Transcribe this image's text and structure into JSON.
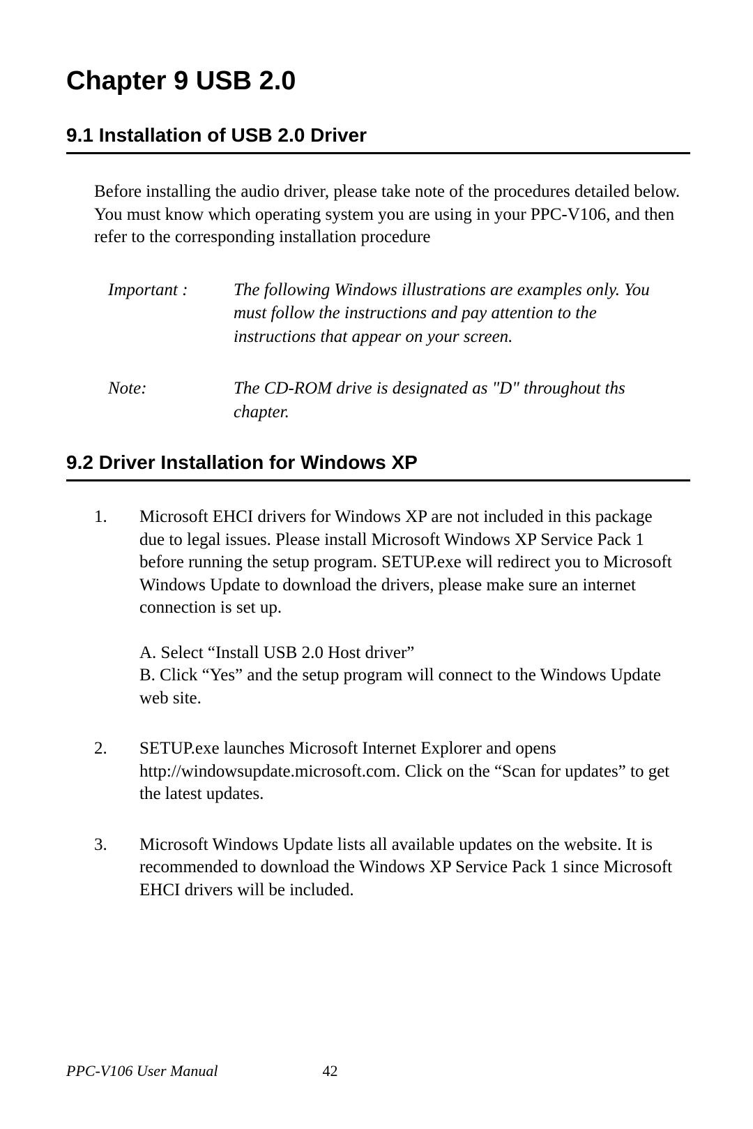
{
  "chapterTitle": "Chapter 9  USB 2.0",
  "section91": {
    "heading": "9.1  Installation of USB 2.0 Driver",
    "paragraph": "Before installing the audio driver, please take note of the procedures detailed below. You must know which operating system you are using in your PPC-V106, and then refer to the corresponding installation procedure"
  },
  "importantRow": {
    "label": "Important :",
    "text": "The following Windows illustrations are examples only. You must follow the instructions and pay attention to the instructions that appear on your screen."
  },
  "noteRow": {
    "label": "Note:",
    "text": "The CD-ROM drive is designated as \"D\" throughout ths chapter."
  },
  "section92": {
    "heading": "9.2  Driver Installation for Windows XP",
    "items": [
      {
        "num": "1.",
        "text": "Microsoft EHCI drivers for Windows XP are not included in this package due to legal issues.  Please install Microsoft Windows XP Service Pack 1 before running the setup program.  SETUP.exe will redirect you to Microsoft Windows Update to download the drivers, please make sure an internet connection is set up.",
        "subA": "A. Select “Install USB 2.0 Host driver”",
        "subB": "B. Click “Yes” and the setup program will connect to the Windows Update web site."
      },
      {
        "num": "2.",
        "text": "SETUP.exe launches Microsoft Internet Explorer and opens http://windowsupdate.microsoft.com.  Click on the “Scan for updates” to get the latest updates."
      },
      {
        "num": "3.",
        "text": "Microsoft Windows Update lists all available updates on the website.  It is recommended to download the Windows XP Service Pack 1 since Microsoft EHCI drivers will be included."
      }
    ]
  },
  "footer": {
    "title": "PPC-V106 User Manual",
    "page": "42"
  }
}
